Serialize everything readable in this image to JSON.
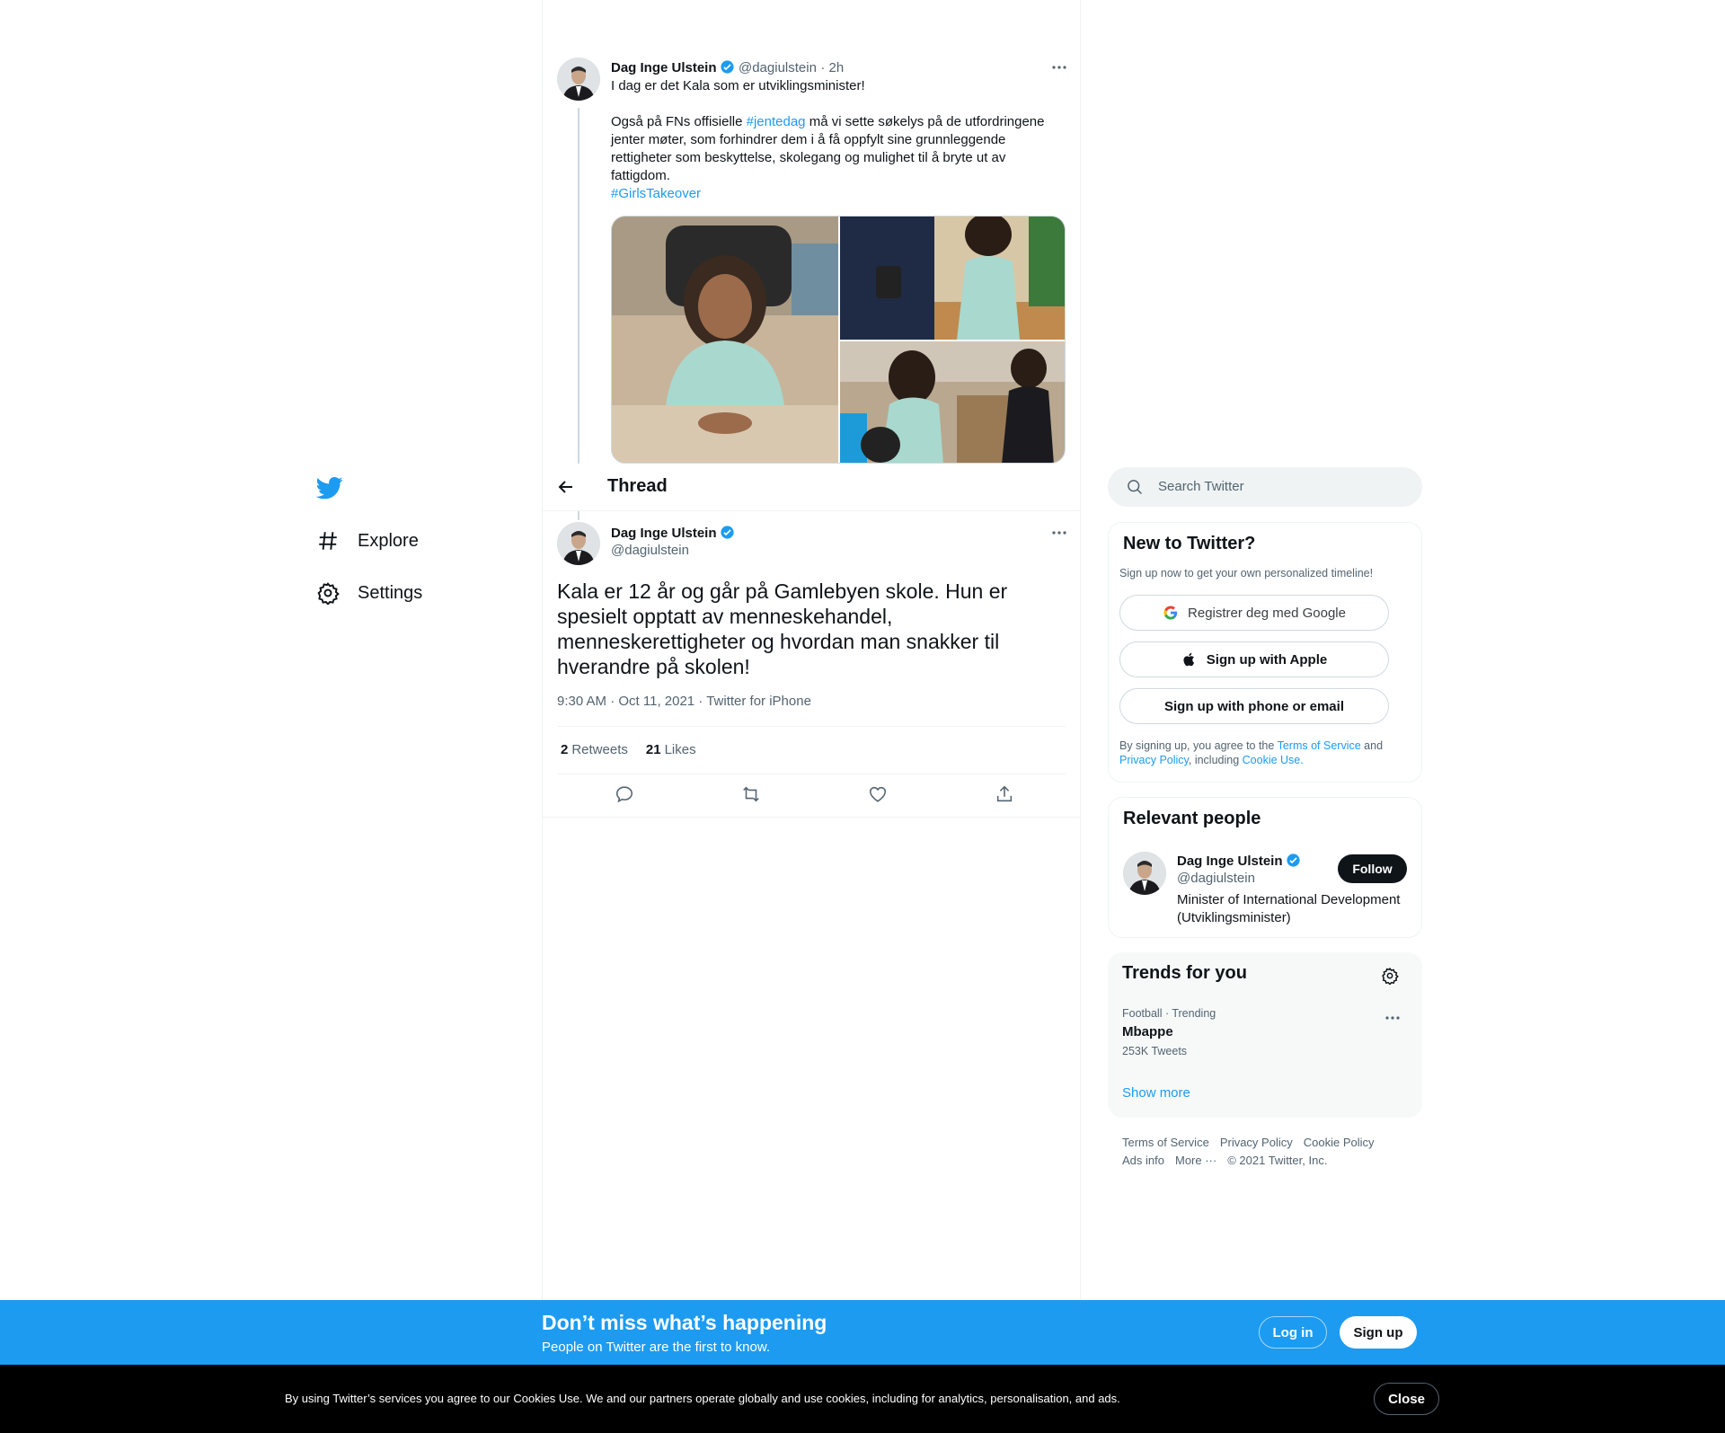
{
  "nav": {
    "explore_label": "Explore",
    "settings_label": "Settings"
  },
  "prev_tweet": {
    "author_name": "Dag Inge Ulstein",
    "handle": "@dagiulstein",
    "time": "· 2h",
    "line1": "I dag er det Kala som er utviklingsminister!",
    "p2_before": "Også på FNs offisielle ",
    "hashtag1": "#jentedag",
    "p2_after": " må vi sette søkelys på de utfordringene jenter møter, som forhindrer dem i å få oppfylt sine grunnleggende rettigheter som beskyttelse, skolegang og mulighet til å bryte ut av fattigdom.",
    "hashtag2": "#GirlsTakeover"
  },
  "thread_header": {
    "title": "Thread"
  },
  "main_tweet": {
    "author_name": "Dag Inge Ulstein",
    "handle": "@dagiulstein",
    "text": "Kala er 12 år og går på Gamlebyen skole. Hun er spesielt opptatt av menneskehandel, menneskerettigheter og hvordan man snakker til hverandre på skolen!",
    "meta": "9:30 AM · Oct 11, 2021 · Twitter for iPhone",
    "retweets_count": "2",
    "retweets_label": "Retweets",
    "likes_count": "21",
    "likes_label": "Likes"
  },
  "search": {
    "placeholder": "Search Twitter"
  },
  "new_to_twitter": {
    "title": "New to Twitter?",
    "subtitle": "Sign up now to get your own personalized timeline!",
    "google_label": "Registrer deg med Google",
    "apple_label": "Sign up with Apple",
    "phone_label": "Sign up with phone or email",
    "legal_1": "By signing up, you agree to the ",
    "terms_link": "Terms of Service",
    "legal_2": " and ",
    "privacy_link": "Privacy Policy",
    "legal_3": ", including ",
    "cookie_link": "Cookie Use."
  },
  "relevant_people": {
    "title": "Relevant people",
    "name": "Dag Inge Ulstein",
    "handle": "@dagiulstein",
    "bio": "Minister of International Development (Utviklingsminister)",
    "follow_label": "Follow"
  },
  "trends": {
    "title": "Trends for you",
    "items": [
      {
        "context": "Football · Trending",
        "name": "Mbappe",
        "count": "253K Tweets"
      }
    ],
    "show_more": "Show more"
  },
  "footer": {
    "links": [
      "Terms of Service",
      "Privacy Policy",
      "Cookie Policy",
      "Ads info",
      "More ···",
      "© 2021 Twitter, Inc."
    ]
  },
  "signup_bar": {
    "heading": "Don’t miss what’s happening",
    "sub": "People on Twitter are the first to know.",
    "login_label": "Log in",
    "signup_label": "Sign up"
  },
  "cookie_bar": {
    "text": "By using Twitter’s services you agree to our Cookies Use. We and our partners operate globally and use cookies, including for analytics, personalisation, and ads.",
    "close_label": "Close"
  },
  "colors": {
    "brand": "#1d9bf0",
    "text": "#0f1419",
    "secondary": "#536471"
  }
}
